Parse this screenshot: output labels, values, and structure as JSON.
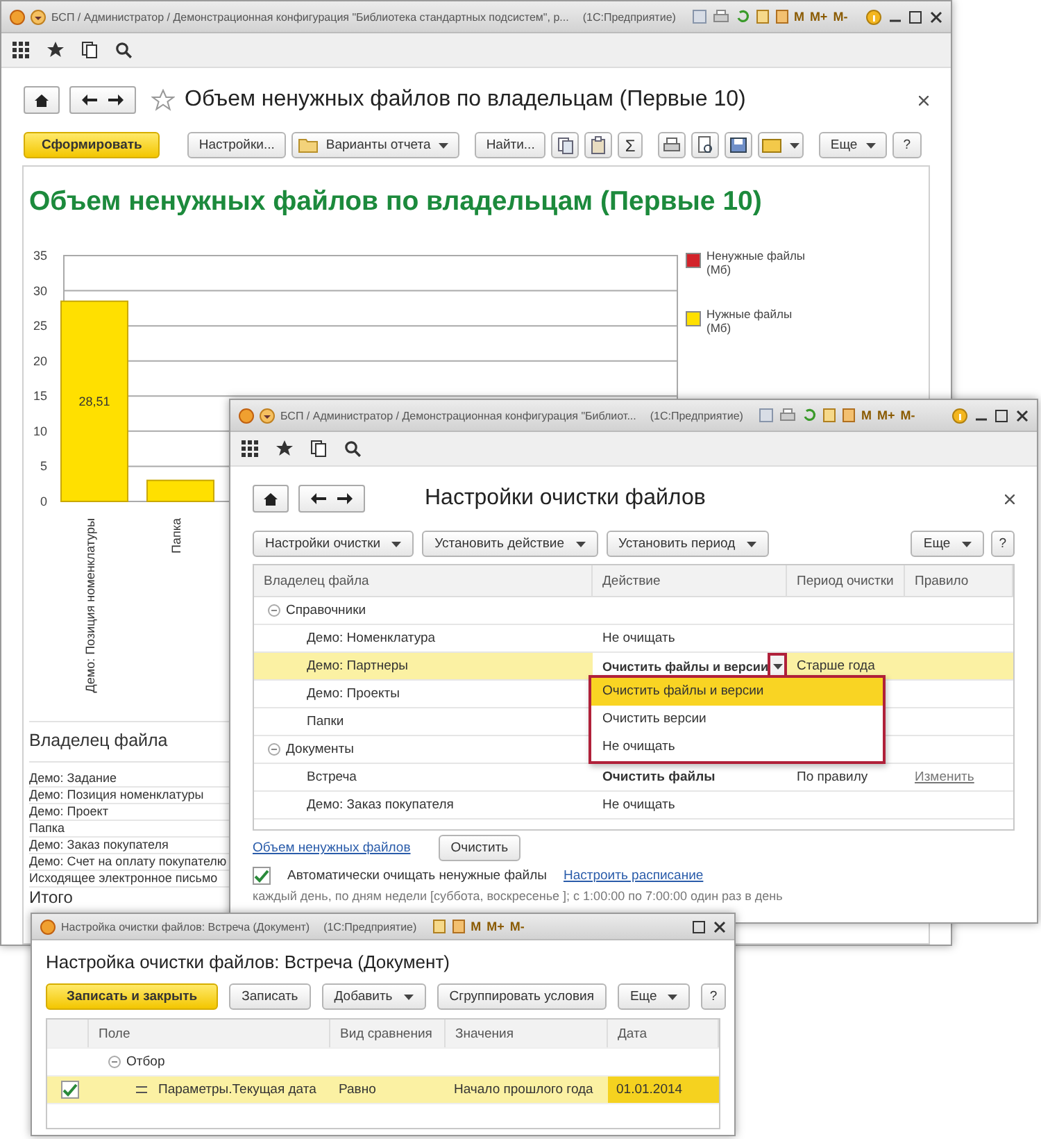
{
  "report_window": {
    "title": "БСП / Администратор / Демонстрационная конфигурация \"Библиотека стандартных подсистем\", р...",
    "app_name": "(1С:Предприятие)",
    "memory_buttons": [
      "M",
      "M+",
      "M-"
    ],
    "page_title": "Объем ненужных файлов по владельцам (Первые 10)",
    "toolbar": [
      {
        "label": "Сформировать",
        "kind": "primary"
      },
      {
        "label": "Настройки...",
        "kind": "button"
      },
      {
        "label": "Варианты отчета",
        "kind": "folder-menu"
      },
      {
        "label": "Найти...",
        "kind": "button"
      }
    ],
    "sum_button": "Σ",
    "more_button": "Еще",
    "help_button": "?",
    "report": {
      "title": "Объем ненужных файлов по владельцам (Первые 10)",
      "chart_data": {
        "type": "bar",
        "categories": [
          "Демо: Позиция номенклатуры",
          "Папка"
        ],
        "series": [
          {
            "name": "Ненужные файлы (Мб)",
            "color": "#d2232a",
            "values": [
              null,
              null
            ]
          },
          {
            "name": "Нужные файлы (Мб)",
            "color": "#ffe000",
            "values": [
              28.5,
              3
            ]
          }
        ],
        "ylim": [
          0,
          35
        ],
        "grid": true,
        "yticks": [
          0,
          5,
          10,
          15,
          20,
          25,
          30,
          35
        ],
        "value_labels": [
          "28,51",
          null
        ]
      },
      "owner_table": {
        "header": "Владелец файла",
        "rows": [
          "Демо: Задание",
          "Демо: Позиция номенклатуры",
          "Демо: Проект",
          "Папка",
          "Демо: Заказ покупателя",
          "Демо: Счет на оплату покупателю",
          "Исходящее электронное письмо"
        ],
        "total": "Итого"
      }
    }
  },
  "settings_window": {
    "title": "БСП / Администратор / Демонстрационная конфигурация \"Библиот...",
    "app_name": "(1С:Предприятие)",
    "memory_buttons": [
      "M",
      "M+",
      "M-"
    ],
    "page_title": "Настройки очистки файлов",
    "toolbar": [
      {
        "label": "Настройки очистки",
        "kind": "menu"
      },
      {
        "label": "Установить действие",
        "kind": "menu"
      },
      {
        "label": "Установить период",
        "kind": "menu"
      }
    ],
    "right_buttons": [
      {
        "label": "Еще",
        "kind": "menu"
      },
      {
        "label": "?",
        "kind": "help"
      }
    ],
    "table": {
      "columns": [
        "Владелец файла",
        "Действие",
        "Период очистки",
        "Правило"
      ],
      "rows": [
        {
          "owner": "Справочники",
          "expanded": true,
          "children": [
            {
              "owner": "Демо: Номенклатура",
              "action": "Не очищать",
              "action_bold": false,
              "selected": false,
              "editing": false
            },
            {
              "owner": "Демо: Партнеры",
              "action": "Очистить файлы и версии",
              "action_bold": true,
              "period": "Старше года",
              "selected": true,
              "editing": true
            },
            {
              "owner": "Демо: Проекты",
              "selected": false,
              "editing": false
            },
            {
              "owner": "Папки",
              "selected": false,
              "editing": false
            }
          ]
        },
        {
          "owner": "Документы",
          "expanded": true,
          "children": [
            {
              "owner": "Встреча",
              "action": "Очистить файлы",
              "action_bold": true,
              "period": "По правилу",
              "rule": "Изменить",
              "selected": false,
              "editing": false
            },
            {
              "owner": "Демо: Заказ покупателя",
              "action": "Не очищать",
              "action_bold": false,
              "selected": false,
              "editing": false
            }
          ]
        }
      ]
    },
    "dropdown": {
      "options": [
        {
          "label": "Очистить файлы и версии",
          "selected": true
        },
        {
          "label": "Очистить версии",
          "selected": false
        },
        {
          "label": "Не очищать",
          "selected": false
        }
      ]
    },
    "volume_link": "Объем ненужных файлов",
    "clear_button": "Очистить",
    "auto_clear": {
      "label": "Автоматически очищать ненужные файлы",
      "checked": true
    },
    "schedule_link": "Настроить расписание",
    "schedule": "каждый  день, по дням недели [суббота, воскресенье ]; с 1:00:00 по 7:00:00 один раз в день"
  },
  "condition_window": {
    "title": "Настройка очистки файлов: Встреча (Документ)",
    "app_name": "(1С:Предприятие)",
    "memory_buttons": [
      "M",
      "M+",
      "M-"
    ],
    "page_title": "Настройка очистки файлов: Встреча (Документ)",
    "toolbar": [
      {
        "label": "Записать и закрыть",
        "kind": "primary"
      },
      {
        "label": "Записать",
        "kind": "button"
      },
      {
        "label": "Добавить",
        "kind": "menu"
      },
      {
        "label": "Сгруппировать условия",
        "kind": "button"
      },
      {
        "label": "Еще",
        "kind": "menu"
      },
      {
        "label": "?",
        "kind": "help"
      }
    ],
    "table": {
      "columns": [
        "Поле",
        "Вид сравнения",
        "Значения",
        "Дата"
      ],
      "rows": [
        {
          "field": "Отбор",
          "expanded": true,
          "children": [
            {
              "field": "Параметры.Текущая дата",
              "checked": true,
              "comparison": "Равно",
              "value": "Начало прошлого года",
              "date": "01.01.2014",
              "selected": true
            }
          ]
        }
      ]
    }
  }
}
